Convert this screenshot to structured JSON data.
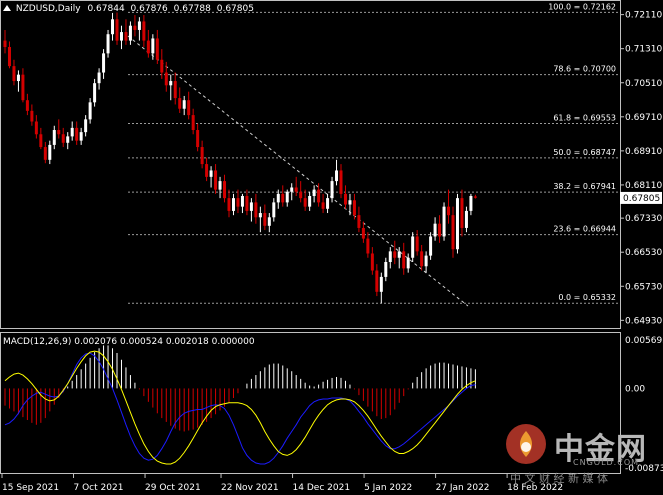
{
  "header": {
    "symbol": "NZDUSD,Daily",
    "open": "0.67844",
    "high": "0.67876",
    "low": "0.67788",
    "close": "0.67805",
    "macd": "MACD(12,26,9) 0.002076 0.000524 0.002018 0.000000"
  },
  "price_axis": [
    "0.72110",
    "0.71310",
    "0.70510",
    "0.69710",
    "0.68910",
    "0.68110",
    "0.67330",
    "0.66530",
    "0.65730",
    "0.64930"
  ],
  "current_price": "0.67805",
  "fib_levels": [
    {
      "label": "100.0 = 0.72162",
      "price": 0.72162
    },
    {
      "label": "78.6 = 0.70700",
      "price": 0.707
    },
    {
      "label": "61.8 = 0.69553",
      "price": 0.69553
    },
    {
      "label": "50.0 = 0.68747",
      "price": 0.68747
    },
    {
      "label": "38.2 = 0.67941",
      "price": 0.67941
    },
    {
      "label": "23.6 = 0.66944",
      "price": 0.66944
    },
    {
      "label": "0.0 = 0.65332",
      "price": 0.65332
    }
  ],
  "macd_axis": {
    "top": "0.005693",
    "zero": "0.00",
    "bottom": "-0.008739"
  },
  "date_axis": [
    "15 Sep 2021",
    "7 Oct 2021",
    "29 Oct 2021",
    "22 Nov 2021",
    "14 Dec 2021",
    "5 Jan 2022",
    "27 Jan 2022",
    "18 Feb 2022"
  ],
  "watermark": {
    "brand": "中金网",
    "url": "CNGOLD.COM",
    "tagline": "中 文 财 经 新 媒 体"
  },
  "colors": {
    "bull": "#ffffff",
    "bear": "#d40000",
    "signal": "#ffff00",
    "macd_line": "#1c1cff",
    "grid": "#808080"
  },
  "chart_data": {
    "type": "candlestick",
    "symbol": "NZDUSD",
    "timeframe": "Daily",
    "price_range": [
      0.6475,
      0.7243
    ],
    "bars": [
      [
        0.715,
        0.7175,
        0.712,
        0.7135
      ],
      [
        0.7135,
        0.7148,
        0.7085,
        0.709
      ],
      [
        0.709,
        0.7105,
        0.7045,
        0.7055
      ],
      [
        0.7055,
        0.708,
        0.703,
        0.707
      ],
      [
        0.707,
        0.7085,
        0.7005,
        0.701
      ],
      [
        0.701,
        0.7025,
        0.6975,
        0.6985
      ],
      [
        0.6985,
        0.7,
        0.695,
        0.696
      ],
      [
        0.696,
        0.6975,
        0.692,
        0.693
      ],
      [
        0.693,
        0.6945,
        0.6895,
        0.69
      ],
      [
        0.69,
        0.6912,
        0.6862,
        0.687
      ],
      [
        0.687,
        0.6915,
        0.686,
        0.6905
      ],
      [
        0.6905,
        0.695,
        0.6895,
        0.694
      ],
      [
        0.694,
        0.6965,
        0.692,
        0.693
      ],
      [
        0.693,
        0.6945,
        0.69,
        0.691
      ],
      [
        0.691,
        0.6935,
        0.6895,
        0.6925
      ],
      [
        0.6925,
        0.696,
        0.6915,
        0.6945
      ],
      [
        0.6945,
        0.696,
        0.6905,
        0.6915
      ],
      [
        0.6915,
        0.6945,
        0.6905,
        0.6935
      ],
      [
        0.6935,
        0.6975,
        0.6925,
        0.6965
      ],
      [
        0.6965,
        0.7015,
        0.6955,
        0.7005
      ],
      [
        0.7005,
        0.706,
        0.6995,
        0.705
      ],
      [
        0.705,
        0.7085,
        0.7035,
        0.7075
      ],
      [
        0.7075,
        0.713,
        0.706,
        0.712
      ],
      [
        0.712,
        0.7175,
        0.711,
        0.7165
      ],
      [
        0.7165,
        0.7215,
        0.715,
        0.72
      ],
      [
        0.72,
        0.7216,
        0.714,
        0.715
      ],
      [
        0.715,
        0.7185,
        0.713,
        0.717
      ],
      [
        0.717,
        0.72,
        0.714,
        0.715
      ],
      [
        0.715,
        0.7195,
        0.714,
        0.7185
      ],
      [
        0.7185,
        0.721,
        0.716,
        0.7175
      ],
      [
        0.7175,
        0.7205,
        0.715,
        0.7195
      ],
      [
        0.7195,
        0.721,
        0.7135,
        0.715
      ],
      [
        0.715,
        0.7175,
        0.711,
        0.712
      ],
      [
        0.712,
        0.7165,
        0.7105,
        0.7155
      ],
      [
        0.7155,
        0.7175,
        0.7095,
        0.7105
      ],
      [
        0.7105,
        0.713,
        0.706,
        0.7075
      ],
      [
        0.7075,
        0.71,
        0.703,
        0.7045
      ],
      [
        0.7045,
        0.707,
        0.701,
        0.7055
      ],
      [
        0.7055,
        0.7075,
        0.7,
        0.7015
      ],
      [
        0.7015,
        0.704,
        0.698,
        0.699
      ],
      [
        0.699,
        0.702,
        0.6975,
        0.701
      ],
      [
        0.701,
        0.703,
        0.6965,
        0.6975
      ],
      [
        0.6975,
        0.699,
        0.693,
        0.694
      ],
      [
        0.694,
        0.6955,
        0.689,
        0.69
      ],
      [
        0.69,
        0.6915,
        0.685,
        0.686
      ],
      [
        0.686,
        0.6875,
        0.682,
        0.683
      ],
      [
        0.683,
        0.6855,
        0.6805,
        0.6845
      ],
      [
        0.6845,
        0.686,
        0.679,
        0.68
      ],
      [
        0.68,
        0.683,
        0.678,
        0.682
      ],
      [
        0.682,
        0.6835,
        0.677,
        0.678
      ],
      [
        0.678,
        0.68,
        0.6735,
        0.675
      ],
      [
        0.675,
        0.679,
        0.674,
        0.678
      ],
      [
        0.678,
        0.68,
        0.6745,
        0.676
      ],
      [
        0.676,
        0.679,
        0.6745,
        0.6785
      ],
      [
        0.6785,
        0.68,
        0.674,
        0.675
      ],
      [
        0.675,
        0.678,
        0.6725,
        0.677
      ],
      [
        0.677,
        0.679,
        0.672,
        0.6735
      ],
      [
        0.6735,
        0.676,
        0.67,
        0.6745
      ],
      [
        0.6745,
        0.6765,
        0.6705,
        0.6715
      ],
      [
        0.6715,
        0.6745,
        0.67,
        0.6735
      ],
      [
        0.6735,
        0.678,
        0.6725,
        0.677
      ],
      [
        0.677,
        0.68,
        0.6755,
        0.679
      ],
      [
        0.679,
        0.681,
        0.676,
        0.677
      ],
      [
        0.677,
        0.68,
        0.676,
        0.6795
      ],
      [
        0.6795,
        0.6815,
        0.6775,
        0.6805
      ],
      [
        0.6805,
        0.683,
        0.6785,
        0.6795
      ],
      [
        0.6795,
        0.682,
        0.677,
        0.678
      ],
      [
        0.678,
        0.68,
        0.675,
        0.676
      ],
      [
        0.676,
        0.6795,
        0.675,
        0.6785
      ],
      [
        0.6785,
        0.681,
        0.677,
        0.68
      ],
      [
        0.68,
        0.6815,
        0.676,
        0.677
      ],
      [
        0.677,
        0.679,
        0.6745,
        0.6755
      ],
      [
        0.6755,
        0.679,
        0.6745,
        0.678
      ],
      [
        0.678,
        0.683,
        0.677,
        0.682
      ],
      [
        0.682,
        0.687,
        0.681,
        0.6845
      ],
      [
        0.6845,
        0.686,
        0.678,
        0.679
      ],
      [
        0.679,
        0.681,
        0.6755,
        0.6765
      ],
      [
        0.6765,
        0.679,
        0.674,
        0.6775
      ],
      [
        0.6775,
        0.679,
        0.673,
        0.674
      ],
      [
        0.674,
        0.676,
        0.67,
        0.671
      ],
      [
        0.671,
        0.6725,
        0.6675,
        0.6685
      ],
      [
        0.6685,
        0.67,
        0.664,
        0.665
      ],
      [
        0.665,
        0.6665,
        0.66,
        0.661
      ],
      [
        0.661,
        0.6625,
        0.655,
        0.656
      ],
      [
        0.656,
        0.6605,
        0.6533,
        0.6595
      ],
      [
        0.6595,
        0.664,
        0.6585,
        0.663
      ],
      [
        0.663,
        0.6665,
        0.6615,
        0.6655
      ],
      [
        0.6655,
        0.668,
        0.6625,
        0.664
      ],
      [
        0.664,
        0.6665,
        0.6615,
        0.6655
      ],
      [
        0.6655,
        0.6675,
        0.66,
        0.6615
      ],
      [
        0.6615,
        0.665,
        0.6605,
        0.664
      ],
      [
        0.664,
        0.67,
        0.663,
        0.669
      ],
      [
        0.669,
        0.6705,
        0.6645,
        0.6655
      ],
      [
        0.6655,
        0.667,
        0.661,
        0.662
      ],
      [
        0.662,
        0.6655,
        0.6605,
        0.6645
      ],
      [
        0.6645,
        0.67,
        0.6635,
        0.669
      ],
      [
        0.669,
        0.6735,
        0.668,
        0.672
      ],
      [
        0.672,
        0.674,
        0.6675,
        0.669
      ],
      [
        0.669,
        0.677,
        0.668,
        0.676
      ],
      [
        0.676,
        0.68,
        0.672,
        0.674
      ],
      [
        0.674,
        0.676,
        0.664,
        0.666
      ],
      [
        0.666,
        0.679,
        0.665,
        0.678
      ],
      [
        0.678,
        0.68,
        0.669,
        0.671
      ],
      [
        0.671,
        0.676,
        0.67,
        0.675
      ],
      [
        0.675,
        0.679,
        0.674,
        0.6785
      ],
      [
        0.6784,
        0.6788,
        0.6779,
        0.6781
      ]
    ],
    "macd": {
      "params": "12,26,9",
      "axis_range": [
        -0.008739,
        0.005693
      ],
      "histogram": [
        -0.0018,
        -0.0021,
        -0.0024,
        -0.0027,
        -0.003,
        -0.0033,
        -0.0036,
        -0.0038,
        -0.0036,
        -0.0031,
        -0.0024,
        -0.0017,
        -0.001,
        -0.0004,
        0.0002,
        0.0008,
        0.0014,
        0.002,
        0.0026,
        0.0032,
        0.0038,
        0.0042,
        0.0045,
        0.0045,
        0.0042,
        0.0037,
        0.003,
        0.0022,
        0.0014,
        0.0006,
        -0.0001,
        -0.0008,
        -0.0014,
        -0.002,
        -0.0026,
        -0.0031,
        -0.0035,
        -0.0039,
        -0.0042,
        -0.0044,
        -0.0045,
        -0.0044,
        -0.0043,
        -0.0041,
        -0.0038,
        -0.0035,
        -0.0031,
        -0.0027,
        -0.0023,
        -0.0019,
        -0.0015,
        -0.001,
        -0.0005,
        0.0,
        0.0005,
        0.001,
        0.0014,
        0.0018,
        0.0022,
        0.0025,
        0.0026,
        0.0026,
        0.0024,
        0.0021,
        0.0018,
        0.0014,
        0.001,
        0.0006,
        0.0003,
        0.0002,
        0.0004,
        0.0007,
        0.0009,
        0.0011,
        0.0012,
        0.0011,
        0.0008,
        0.0004,
        -0.0001,
        -0.0007,
        -0.0013,
        -0.0019,
        -0.0024,
        -0.0029,
        -0.0032,
        -0.0031,
        -0.0028,
        -0.0022,
        -0.0015,
        -0.0008,
        -0.0001,
        0.0006,
        0.0012,
        0.0017,
        0.0021,
        0.0024,
        0.0026,
        0.0027,
        0.0027,
        0.0026,
        0.0025,
        0.0024,
        0.0023,
        0.0022,
        0.0021,
        0.002
      ],
      "macd_line": [
        -0.0038,
        -0.0036,
        -0.0032,
        -0.0026,
        -0.0018,
        -0.0012,
        -0.0008,
        -0.0005,
        -0.0004,
        -0.0006,
        -0.0008,
        -0.0009,
        -0.0008,
        -0.0003,
        0.0005,
        0.0015,
        0.0025,
        0.0032,
        0.0036,
        0.0037,
        0.0034,
        0.0028,
        0.002,
        0.001,
        0.0,
        -0.0012,
        -0.0025,
        -0.0038,
        -0.005,
        -0.006,
        -0.0068,
        -0.0073,
        -0.0075,
        -0.0074,
        -0.007,
        -0.0063,
        -0.0055,
        -0.0045,
        -0.0036,
        -0.003,
        -0.0026,
        -0.0024,
        -0.0023,
        -0.0022,
        -0.0022,
        -0.002,
        -0.0018,
        -0.0017,
        -0.0018,
        -0.0021,
        -0.0028,
        -0.0038,
        -0.005,
        -0.0062,
        -0.007,
        -0.0075,
        -0.0078,
        -0.0079,
        -0.0079,
        -0.0077,
        -0.0073,
        -0.0067,
        -0.006,
        -0.0052,
        -0.0045,
        -0.0038,
        -0.003,
        -0.0024,
        -0.0018,
        -0.0014,
        -0.0012,
        -0.0011,
        -0.0011,
        -0.001,
        -0.001,
        -0.001,
        -0.0011,
        -0.0013,
        -0.0018,
        -0.0024,
        -0.003,
        -0.0037,
        -0.0043,
        -0.0049,
        -0.0055,
        -0.006,
        -0.0063,
        -0.0063,
        -0.0061,
        -0.0058,
        -0.0054,
        -0.005,
        -0.0046,
        -0.0042,
        -0.0038,
        -0.0034,
        -0.003,
        -0.0026,
        -0.0022,
        -0.0018,
        -0.0013,
        -0.0008,
        -0.0004,
        0.0,
        0.0003,
        0.0004
      ],
      "signal_line": [
        0.0008,
        0.0012,
        0.0015,
        0.0016,
        0.0014,
        0.001,
        0.0005,
        -0.0001,
        -0.0007,
        -0.0011,
        -0.0013,
        -0.0012,
        -0.0008,
        -0.0002,
        0.0005,
        0.0013,
        0.0021,
        0.0028,
        0.0034,
        0.0038,
        0.0039,
        0.0038,
        0.0034,
        0.0028,
        0.002,
        0.001,
        -0.0001,
        -0.0013,
        -0.0025,
        -0.0037,
        -0.0048,
        -0.0058,
        -0.0066,
        -0.0072,
        -0.0076,
        -0.0078,
        -0.0079,
        -0.0079,
        -0.0077,
        -0.0073,
        -0.0067,
        -0.006,
        -0.0052,
        -0.0044,
        -0.0036,
        -0.0029,
        -0.0023,
        -0.0019,
        -0.0017,
        -0.0016,
        -0.0015,
        -0.0015,
        -0.0015,
        -0.0016,
        -0.0018,
        -0.0022,
        -0.0028,
        -0.0036,
        -0.0045,
        -0.0053,
        -0.006,
        -0.0066,
        -0.0069,
        -0.007,
        -0.0068,
        -0.0064,
        -0.0058,
        -0.0051,
        -0.0043,
        -0.0035,
        -0.0028,
        -0.0022,
        -0.0017,
        -0.0014,
        -0.0012,
        -0.0011,
        -0.0011,
        -0.0012,
        -0.0014,
        -0.0018,
        -0.0023,
        -0.0029,
        -0.0036,
        -0.0043,
        -0.005,
        -0.0056,
        -0.0062,
        -0.0066,
        -0.0068,
        -0.0068,
        -0.0066,
        -0.0063,
        -0.0059,
        -0.0054,
        -0.0048,
        -0.0042,
        -0.0036,
        -0.003,
        -0.0024,
        -0.0018,
        -0.0012,
        -0.0006,
        -0.0001,
        0.0003,
        0.0006,
        0.0008
      ]
    }
  }
}
